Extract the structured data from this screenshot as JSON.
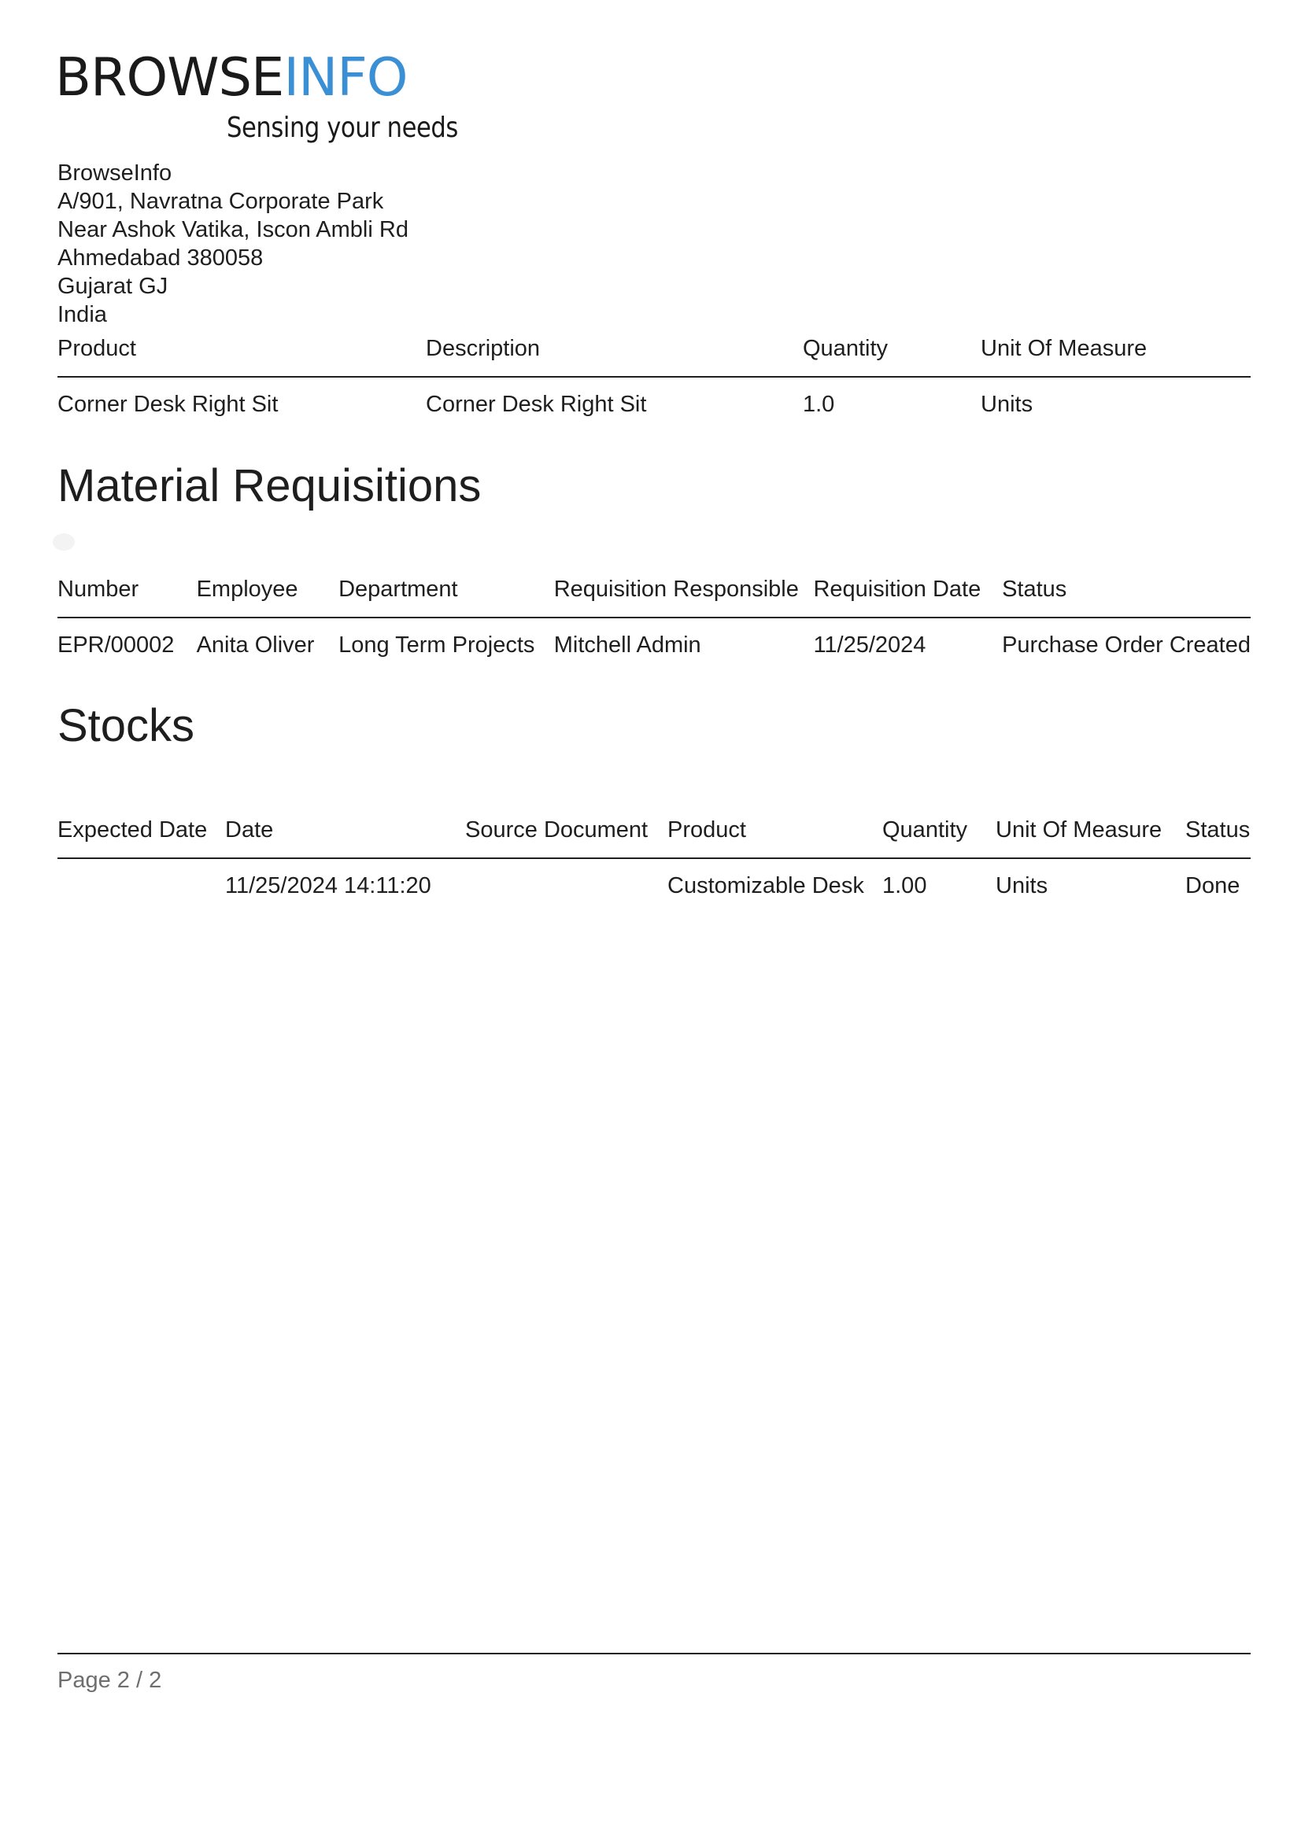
{
  "logo": {
    "word_dark": "BROWSE",
    "word_blue": "INFO",
    "tagline": "Sensing your needs",
    "colors": {
      "dark": "#1a1a1a",
      "blue": "#3b8fd4"
    }
  },
  "company": {
    "name": "BrowseInfo",
    "address_lines": [
      "A/901, Navratna Corporate Park",
      "Near Ashok Vatika, Iscon Ambli Rd",
      "Ahmedabad 380058",
      "Gujarat GJ",
      "India"
    ]
  },
  "products_table": {
    "headers": [
      "Product",
      "Description",
      "Quantity",
      "Unit Of Measure"
    ],
    "rows": [
      [
        "Corner Desk Right Sit",
        "Corner Desk Right Sit",
        "1.0",
        "Units"
      ]
    ]
  },
  "requisitions": {
    "title": "Material Requisitions",
    "headers": [
      "Number",
      "Employee",
      "Department",
      "Requisition Responsible",
      "Requisition Date",
      "Status"
    ],
    "rows": [
      [
        "EPR/00002",
        "Anita Oliver",
        "Long Term Projects",
        "Mitchell Admin",
        "11/25/2024",
        "Purchase Order Created"
      ]
    ]
  },
  "stocks": {
    "title": "Stocks",
    "headers": [
      "Expected Date",
      "Date",
      "Source Document",
      "Product",
      "Quantity",
      "Unit Of Measure",
      "Status"
    ],
    "rows": [
      [
        "",
        "11/25/2024 14:11:20",
        "",
        "Customizable Desk",
        "1.00",
        "Units",
        "Done"
      ]
    ]
  },
  "footer": {
    "page_label": "Page 2 / 2"
  }
}
